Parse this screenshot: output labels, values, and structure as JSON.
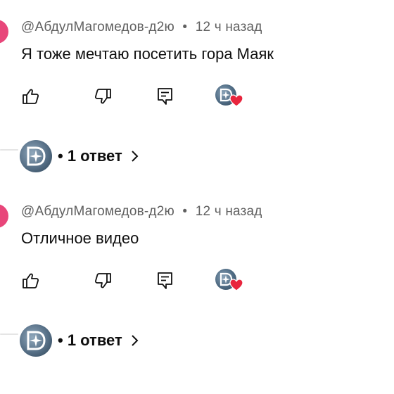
{
  "comments": [
    {
      "author": "@АбдулМагомедов-д2ю",
      "separator": "•",
      "time": "12 ч назад",
      "text": "Я тоже мечтаю посетить гора Маяк",
      "replies_label": "• 1 ответ",
      "icons": [
        "like-icon",
        "dislike-icon",
        "reply-icon",
        "heart-icon",
        "chevron-right-icon"
      ]
    },
    {
      "author": "@АбдулМагомедов-д2ю",
      "separator": "•",
      "time": "12 ч назад",
      "text": "Отличное видео",
      "replies_label": "• 1 ответ",
      "icons": [
        "like-icon",
        "dislike-icon",
        "reply-icon",
        "heart-icon",
        "chevron-right-icon"
      ]
    }
  ],
  "colors": {
    "avatar_pink": "#e8467a",
    "heart_red": "#e8253d",
    "meta_gray": "#606060",
    "text": "#0f0f0f"
  }
}
